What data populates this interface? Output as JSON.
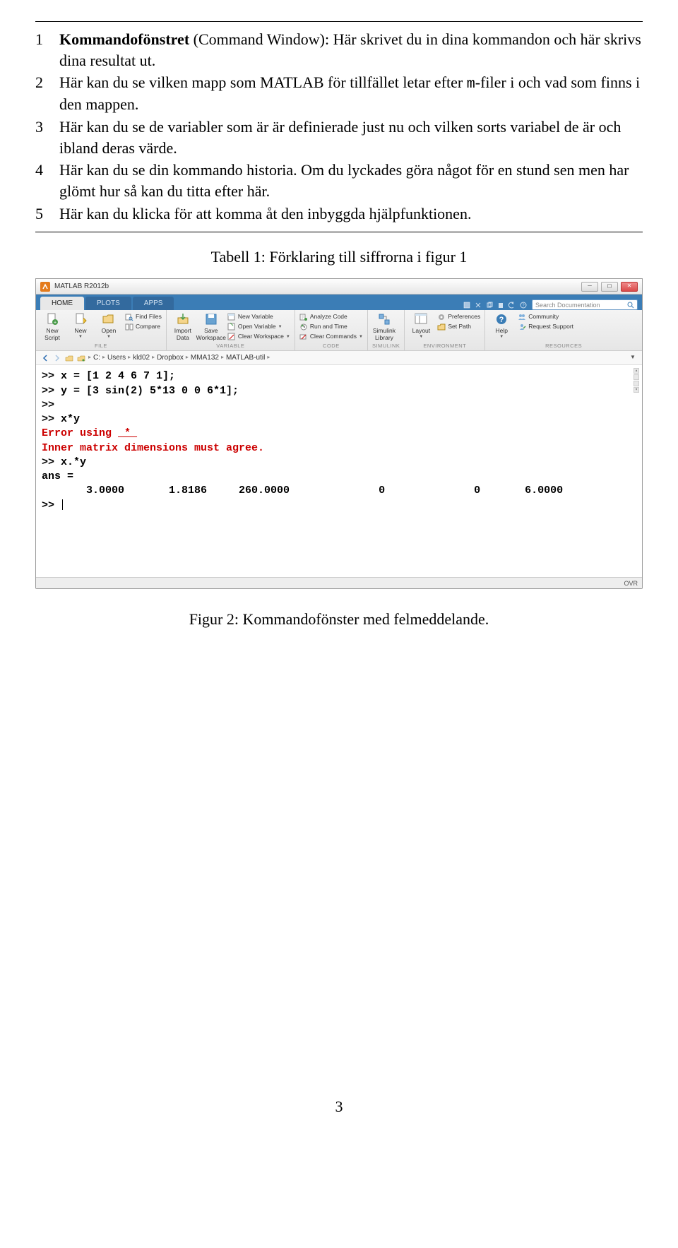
{
  "list": {
    "items": [
      {
        "num": "1",
        "bold": "Kommandofönstret",
        "paren": " (Command Window):",
        "rest": " Här skrivet du in dina kommandon och här skrivs dina resultat ut."
      },
      {
        "num": "2",
        "text_a": "Här kan du se vilken mapp som MATLAB för tillfället letar efter ",
        "mono": "m",
        "text_b": "-filer i och vad som finns i den mappen."
      },
      {
        "num": "3",
        "text": "Här kan du se de variabler som är är definierade just nu och vilken sorts variabel de är och ibland deras värde."
      },
      {
        "num": "4",
        "text": "Här kan du se din kommando historia. Om du lyckades göra något för en stund sen men har glömt hur så kan du titta efter här."
      },
      {
        "num": "5",
        "text": "Här kan du klicka för att komma åt den inbyggda hjälpfunktionen."
      }
    ]
  },
  "table_caption": "Tabell 1: Förklaring till siffrorna i figur 1",
  "matlab": {
    "title": "MATLAB R2012b",
    "tabs": [
      "HOME",
      "PLOTS",
      "APPS"
    ],
    "search_placeholder": "Search Documentation",
    "groups": {
      "file": {
        "label": "FILE",
        "new_script": "New\nScript",
        "new": "New",
        "open": "Open",
        "find_files": "Find Files",
        "compare": "Compare"
      },
      "variable": {
        "label": "VARIABLE",
        "import": "Import\nData",
        "save": "Save\nWorkspace",
        "new_var": "New Variable",
        "open_var": "Open Variable",
        "clear_ws": "Clear Workspace"
      },
      "code": {
        "label": "CODE",
        "analyze": "Analyze Code",
        "run_time": "Run and Time",
        "clear_cmd": "Clear Commands"
      },
      "simulink": {
        "label": "SIMULINK",
        "lib": "Simulink\nLibrary"
      },
      "env": {
        "label": "ENVIRONMENT",
        "layout": "Layout",
        "prefs": "Preferences",
        "setpath": "Set Path"
      },
      "res": {
        "label": "RESOURCES",
        "help": "Help",
        "community": "Community",
        "support": "Request Support"
      }
    },
    "path": [
      "C:",
      "Users",
      "kld02",
      "Dropbox",
      "MMA132",
      "MATLAB-util"
    ],
    "console": {
      "l1": ">> x = [1 2 4 6 7 1];",
      "l2": ">> y = [3 sin(2) 5*13 0 0 6*1];",
      "l3": ">>",
      "l4": ">> x*y",
      "l5a": "Error using ",
      "l5b": " * ",
      "l6": "Inner matrix dimensions must agree.",
      "l7": "",
      "l8": ">> x.*y",
      "l9": "",
      "l10": "ans =",
      "l11": "",
      "l12": "       3.0000       1.8186     260.0000              0              0       6.0000",
      "l13": "",
      "l14": ">> "
    },
    "status": "OVR"
  },
  "fig_caption": "Figur 2: Kommandofönster med felmeddelande.",
  "page": "3"
}
